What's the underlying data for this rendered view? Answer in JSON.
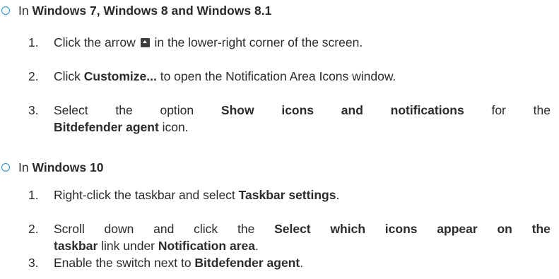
{
  "sections": [
    {
      "intro": "In ",
      "os": "Windows 7, Windows 8 and Windows 8.1",
      "steps": [
        {
          "num": "1.",
          "t1": "Click the arrow",
          "icon": "expand-arrow-icon",
          "t2": " in the lower-right corner of the screen."
        },
        {
          "num": "2.",
          "t1": "Click ",
          "b1": "Customize...",
          "t2": " to open the Notification Area Icons window."
        },
        {
          "num": "3.",
          "w1": "Select",
          "w2": "the",
          "w3": "option",
          "b1": "Show",
          "b2": "icons",
          "b3": "and",
          "b4": "notifications",
          "w4": "for",
          "w5": "the",
          "b5": "Bitdefender agent",
          "t_end": " icon."
        }
      ]
    },
    {
      "intro": "In ",
      "os": "Windows 10",
      "steps": [
        {
          "num": "1.",
          "t1": "Right-click the taskbar and select ",
          "b1": "Taskbar settings",
          "t2": "."
        },
        {
          "num": "2.",
          "w1": "Scroll",
          "w2": "down",
          "w3": "and",
          "w4": "click",
          "w5": "the",
          "b1": "Select",
          "b2": "which",
          "b3": "icons",
          "b4": "appear",
          "b5": "on",
          "b6": "the",
          "b7": "taskbar",
          "t1": " link under ",
          "b8": "Notification area",
          "t2": "."
        },
        {
          "num": "3.",
          "t1": "Enable the switch next to ",
          "b1": "Bitdefender agent",
          "t2": "."
        }
      ]
    }
  ],
  "colors": {
    "bullet": "#1e90d6",
    "text": "#2b2b2b",
    "icon": "#3d3d3d"
  }
}
